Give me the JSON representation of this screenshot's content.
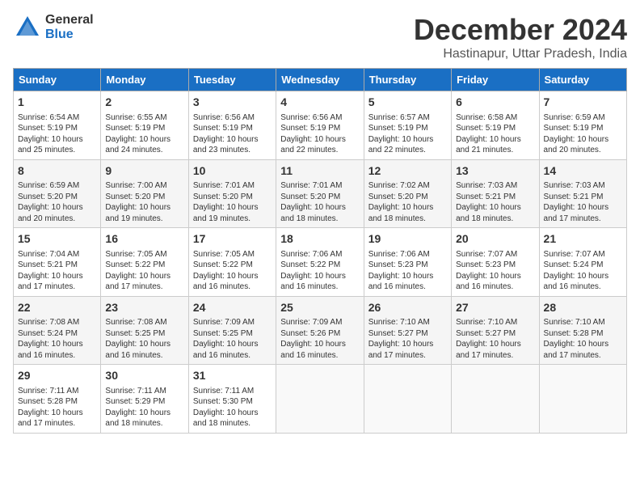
{
  "header": {
    "logo_general": "General",
    "logo_blue": "Blue",
    "month_title": "December 2024",
    "location": "Hastinapur, Uttar Pradesh, India"
  },
  "weekdays": [
    "Sunday",
    "Monday",
    "Tuesday",
    "Wednesday",
    "Thursday",
    "Friday",
    "Saturday"
  ],
  "weeks": [
    [
      {
        "day": "1",
        "info": "Sunrise: 6:54 AM\nSunset: 5:19 PM\nDaylight: 10 hours\nand 25 minutes."
      },
      {
        "day": "2",
        "info": "Sunrise: 6:55 AM\nSunset: 5:19 PM\nDaylight: 10 hours\nand 24 minutes."
      },
      {
        "day": "3",
        "info": "Sunrise: 6:56 AM\nSunset: 5:19 PM\nDaylight: 10 hours\nand 23 minutes."
      },
      {
        "day": "4",
        "info": "Sunrise: 6:56 AM\nSunset: 5:19 PM\nDaylight: 10 hours\nand 22 minutes."
      },
      {
        "day": "5",
        "info": "Sunrise: 6:57 AM\nSunset: 5:19 PM\nDaylight: 10 hours\nand 22 minutes."
      },
      {
        "day": "6",
        "info": "Sunrise: 6:58 AM\nSunset: 5:19 PM\nDaylight: 10 hours\nand 21 minutes."
      },
      {
        "day": "7",
        "info": "Sunrise: 6:59 AM\nSunset: 5:19 PM\nDaylight: 10 hours\nand 20 minutes."
      }
    ],
    [
      {
        "day": "8",
        "info": "Sunrise: 6:59 AM\nSunset: 5:20 PM\nDaylight: 10 hours\nand 20 minutes."
      },
      {
        "day": "9",
        "info": "Sunrise: 7:00 AM\nSunset: 5:20 PM\nDaylight: 10 hours\nand 19 minutes."
      },
      {
        "day": "10",
        "info": "Sunrise: 7:01 AM\nSunset: 5:20 PM\nDaylight: 10 hours\nand 19 minutes."
      },
      {
        "day": "11",
        "info": "Sunrise: 7:01 AM\nSunset: 5:20 PM\nDaylight: 10 hours\nand 18 minutes."
      },
      {
        "day": "12",
        "info": "Sunrise: 7:02 AM\nSunset: 5:20 PM\nDaylight: 10 hours\nand 18 minutes."
      },
      {
        "day": "13",
        "info": "Sunrise: 7:03 AM\nSunset: 5:21 PM\nDaylight: 10 hours\nand 18 minutes."
      },
      {
        "day": "14",
        "info": "Sunrise: 7:03 AM\nSunset: 5:21 PM\nDaylight: 10 hours\nand 17 minutes."
      }
    ],
    [
      {
        "day": "15",
        "info": "Sunrise: 7:04 AM\nSunset: 5:21 PM\nDaylight: 10 hours\nand 17 minutes."
      },
      {
        "day": "16",
        "info": "Sunrise: 7:05 AM\nSunset: 5:22 PM\nDaylight: 10 hours\nand 17 minutes."
      },
      {
        "day": "17",
        "info": "Sunrise: 7:05 AM\nSunset: 5:22 PM\nDaylight: 10 hours\nand 16 minutes."
      },
      {
        "day": "18",
        "info": "Sunrise: 7:06 AM\nSunset: 5:22 PM\nDaylight: 10 hours\nand 16 minutes."
      },
      {
        "day": "19",
        "info": "Sunrise: 7:06 AM\nSunset: 5:23 PM\nDaylight: 10 hours\nand 16 minutes."
      },
      {
        "day": "20",
        "info": "Sunrise: 7:07 AM\nSunset: 5:23 PM\nDaylight: 10 hours\nand 16 minutes."
      },
      {
        "day": "21",
        "info": "Sunrise: 7:07 AM\nSunset: 5:24 PM\nDaylight: 10 hours\nand 16 minutes."
      }
    ],
    [
      {
        "day": "22",
        "info": "Sunrise: 7:08 AM\nSunset: 5:24 PM\nDaylight: 10 hours\nand 16 minutes."
      },
      {
        "day": "23",
        "info": "Sunrise: 7:08 AM\nSunset: 5:25 PM\nDaylight: 10 hours\nand 16 minutes."
      },
      {
        "day": "24",
        "info": "Sunrise: 7:09 AM\nSunset: 5:25 PM\nDaylight: 10 hours\nand 16 minutes."
      },
      {
        "day": "25",
        "info": "Sunrise: 7:09 AM\nSunset: 5:26 PM\nDaylight: 10 hours\nand 16 minutes."
      },
      {
        "day": "26",
        "info": "Sunrise: 7:10 AM\nSunset: 5:27 PM\nDaylight: 10 hours\nand 17 minutes."
      },
      {
        "day": "27",
        "info": "Sunrise: 7:10 AM\nSunset: 5:27 PM\nDaylight: 10 hours\nand 17 minutes."
      },
      {
        "day": "28",
        "info": "Sunrise: 7:10 AM\nSunset: 5:28 PM\nDaylight: 10 hours\nand 17 minutes."
      }
    ],
    [
      {
        "day": "29",
        "info": "Sunrise: 7:11 AM\nSunset: 5:28 PM\nDaylight: 10 hours\nand 17 minutes."
      },
      {
        "day": "30",
        "info": "Sunrise: 7:11 AM\nSunset: 5:29 PM\nDaylight: 10 hours\nand 18 minutes."
      },
      {
        "day": "31",
        "info": "Sunrise: 7:11 AM\nSunset: 5:30 PM\nDaylight: 10 hours\nand 18 minutes."
      },
      {
        "day": "",
        "info": ""
      },
      {
        "day": "",
        "info": ""
      },
      {
        "day": "",
        "info": ""
      },
      {
        "day": "",
        "info": ""
      }
    ]
  ]
}
